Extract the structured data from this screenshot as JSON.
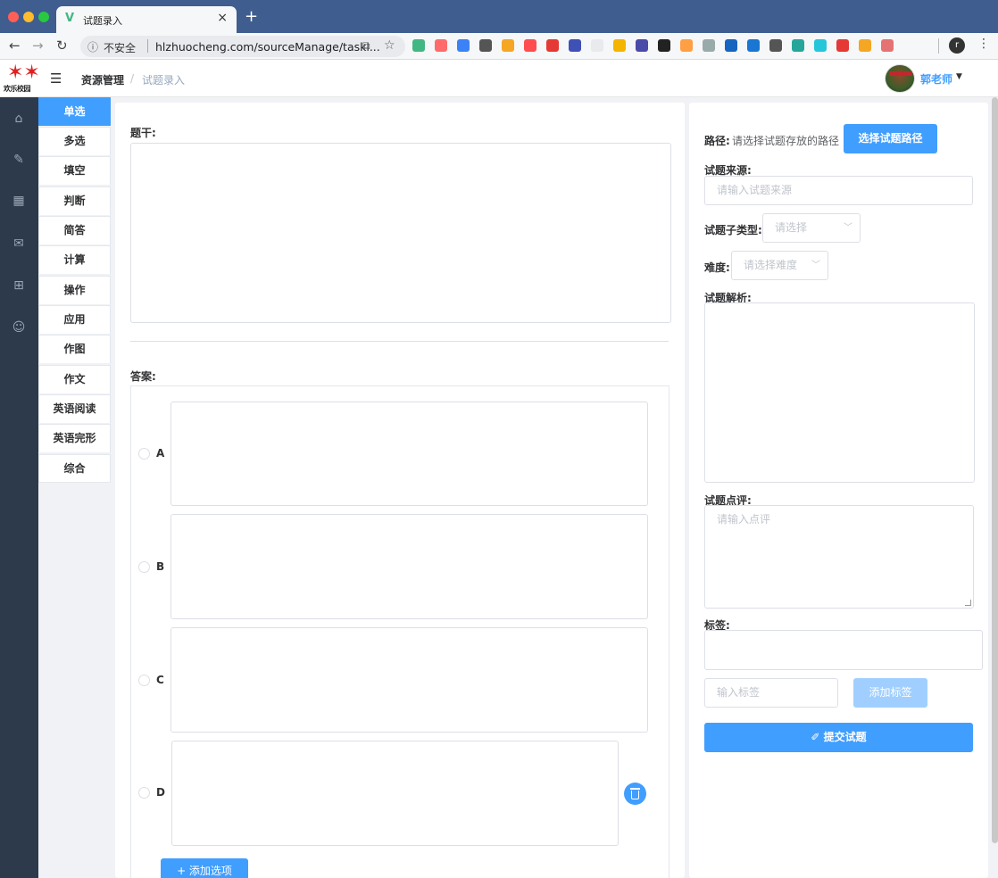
{
  "browser": {
    "tab_title": "试题录入",
    "tab_favicon": "V",
    "new_tab": "+",
    "tab_close": "×",
    "insecure_label": "不安全",
    "url": "hlzhuocheng.com/sourceManage/taskl...",
    "profile_initial": "r",
    "extension_colors": [
      "#41b883",
      "#ff6b6b",
      "#3b82f6",
      "#555",
      "#f5a623",
      "#ff4d4f",
      "#e53935",
      "#3f51b5",
      "#e8eaed",
      "#f4b400",
      "#4a4aa8",
      "#222",
      "#ff9f43",
      "#9aa",
      "#1565c0",
      "#1976d2",
      "#555",
      "#26a69a",
      "#26c6da",
      "#e53935",
      "#f5a623",
      "#e57373"
    ]
  },
  "header": {
    "breadcrumb_root": "资源管理",
    "breadcrumb_separator": "/",
    "breadcrumb_current": "试题录入",
    "user_name": "郭老师",
    "logo_text": "欢乐校园"
  },
  "rail_icons": [
    "home-icon",
    "edit-icon",
    "building-icon",
    "inbox-icon",
    "presentation-icon",
    "user-icon"
  ],
  "question_types": [
    {
      "label": "单选",
      "active": true
    },
    {
      "label": "多选"
    },
    {
      "label": "填空"
    },
    {
      "label": "判断"
    },
    {
      "label": "简答"
    },
    {
      "label": "计算"
    },
    {
      "label": "操作"
    },
    {
      "label": "应用"
    },
    {
      "label": "作图"
    },
    {
      "label": "作文"
    },
    {
      "label": "英语阅读"
    },
    {
      "label": "英语完形"
    },
    {
      "label": "综合"
    }
  ],
  "form": {
    "stem_label": "题干:",
    "answer_label": "答案:",
    "options": [
      "A",
      "B",
      "C",
      "D"
    ],
    "add_option_label": "+ 添加选项"
  },
  "right": {
    "path_label": "路径:",
    "path_placeholder": "请选择试题存放的路径",
    "choose_path_button": "选择试题路径",
    "source_label": "试题来源:",
    "source_placeholder": "请输入试题来源",
    "subtype_label": "试题子类型:",
    "subtype_placeholder": "请选择",
    "difficulty_label": "难度:",
    "difficulty_placeholder": "请选择难度",
    "analysis_label": "试题解析:",
    "comment_label": "试题点评:",
    "comment_placeholder": "请输入点评",
    "tags_label": "标签:",
    "tag_input_placeholder": "输入标签",
    "add_tag_button": "添加标签",
    "submit_button": "✐ 提交试题"
  }
}
